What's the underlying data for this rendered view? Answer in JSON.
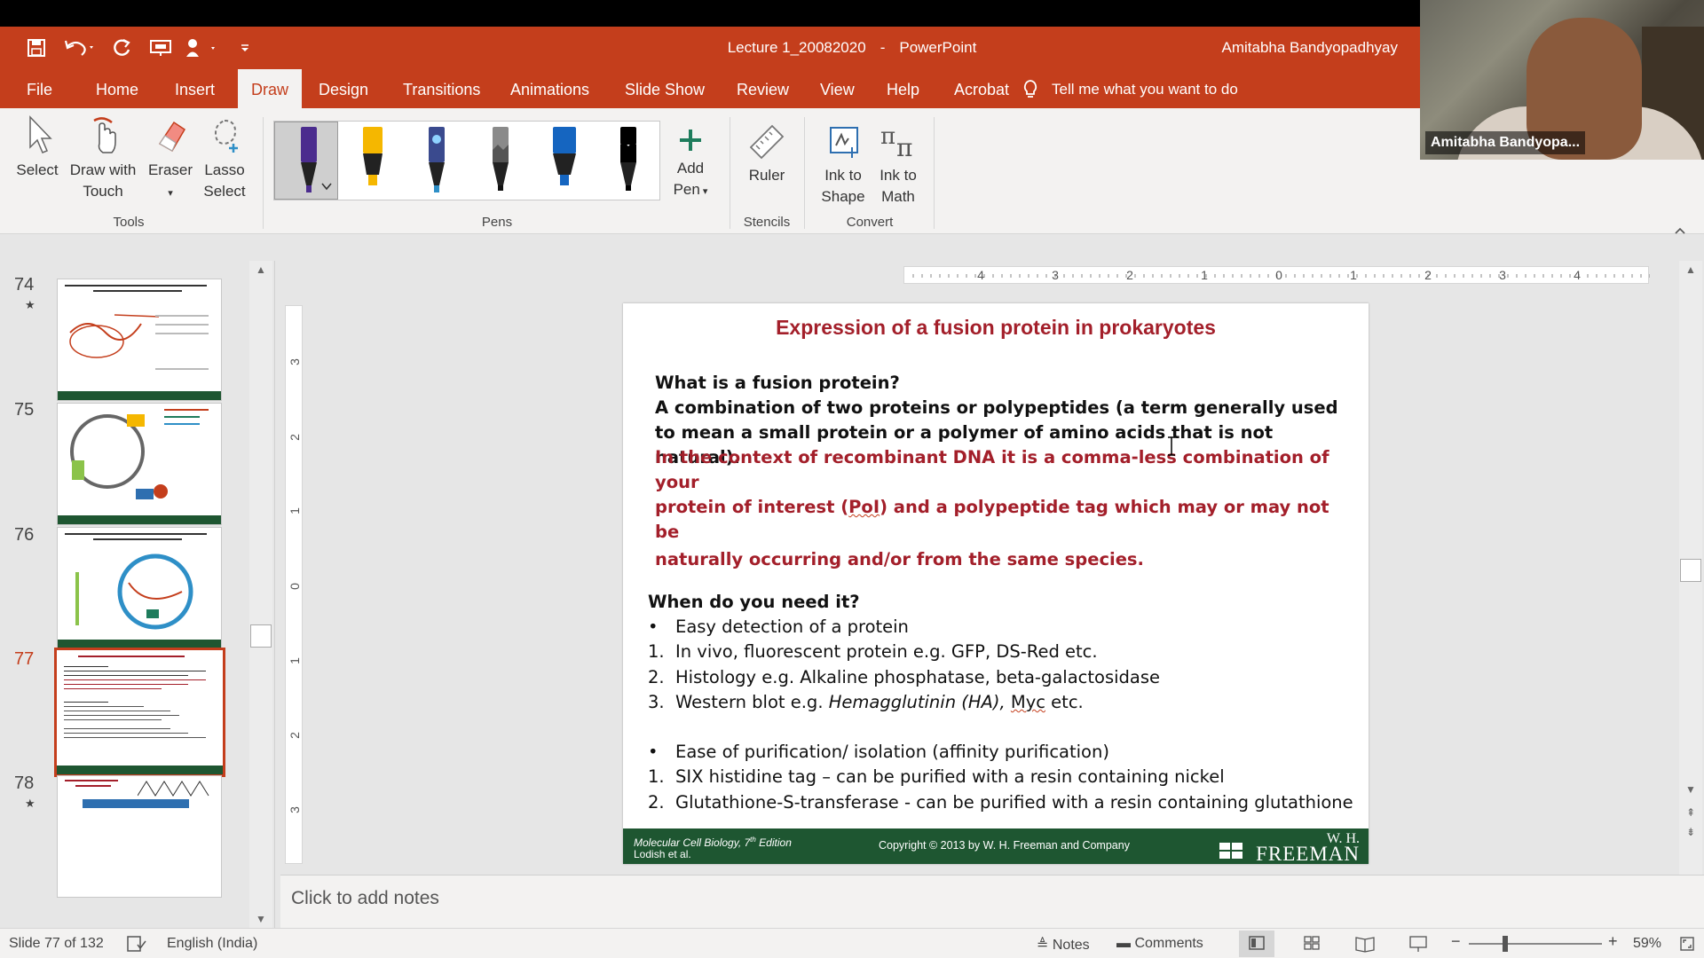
{
  "window": {
    "doc_name": "Lecture 1_20082020",
    "separator": "-",
    "app_name": "PowerPoint",
    "user": "Amitabha Bandyopadhyay"
  },
  "ribbon_tabs": [
    "File",
    "Home",
    "Insert",
    "Draw",
    "Design",
    "Transitions",
    "Animations",
    "Slide Show",
    "Review",
    "View",
    "Help",
    "Acrobat"
  ],
  "active_tab": "Draw",
  "tell_me": "Tell me what you want to do",
  "ribbon": {
    "tools": {
      "select": "Select",
      "draw_touch_1": "Draw with",
      "draw_touch_2": "Touch",
      "eraser": "Eraser",
      "lasso_1": "Lasso",
      "lasso_2": "Select",
      "label": "Tools"
    },
    "pens_label": "Pens",
    "pen_colors": [
      "#4b2c8e",
      "#f5b700",
      "#2e8fc7",
      "#8a8a8a",
      "#1565c0",
      "#000000"
    ],
    "add_pen_1": "Add",
    "add_pen_2": "Pen",
    "ruler": "Ruler",
    "stencils_label": "Stencils",
    "ink_shape_1": "Ink to",
    "ink_shape_2": "Shape",
    "ink_math_1": "Ink to",
    "ink_math_2": "Math",
    "convert_label": "Convert"
  },
  "webcam": {
    "name": "Amitabha Bandyopa..."
  },
  "thumbnails": [
    {
      "num": "74",
      "star": "★"
    },
    {
      "num": "75",
      "star": ""
    },
    {
      "num": "76",
      "star": ""
    },
    {
      "num": "77",
      "star": ""
    },
    {
      "num": "78",
      "star": "★"
    }
  ],
  "ruler": {
    "h_numbers": [
      "4",
      "3",
      "2",
      "1",
      "0",
      "1",
      "2",
      "3",
      "4"
    ],
    "v_numbers": [
      "3",
      "2",
      "1",
      "0",
      "1",
      "2",
      "3"
    ]
  },
  "slide": {
    "title": "Expression of a fusion protein in prokaryotes",
    "question": "What is a fusion protein?",
    "definition": "A combination of two proteins or polypeptides (a term generally used to mean a small protein or a polymer of amino acids that is not natural).",
    "context_1": "In the context of recombinant DNA it is a comma-less combination of your",
    "context_2a": "protein of interest (",
    "context_2b": "PoI",
    "context_2c": ") and a polypeptide tag which may or may not be",
    "context_3": "naturally occurring and/or from the same species.",
    "need_heading": "When do you need it?",
    "list1": [
      {
        "marker": "•",
        "text": "Easy detection of a protein"
      },
      {
        "marker": "1.",
        "text": "In vivo, fluorescent protein e.g. GFP, DS-Red etc."
      },
      {
        "marker": "2.",
        "text": "Histology e.g. Alkaline phosphatase, beta-galactosidase"
      }
    ],
    "western_marker": "3.",
    "western_a": "Western blot e.g. ",
    "western_b": "Hemagglutinin (HA)",
    "western_c": ", ",
    "western_d": "Myc",
    "western_e": " etc.",
    "list2": [
      {
        "marker": "•",
        "text": "Ease of purification/ isolation (affinity purification)"
      },
      {
        "marker": "1.",
        "text": "SIX histidine tag – can be purified with a resin containing nickel"
      },
      {
        "marker": "2.",
        "text": "Glutathione-S-transferase - can be purified with a resin containing glutathione"
      }
    ],
    "footer": {
      "book_a": "Molecular Cell Biology, 7",
      "book_sup": "th",
      "book_b": " Edition",
      "authors": "Lodish et al.",
      "copyright": "Copyright © 2013 by W. H. Freeman and Company",
      "logo_top": "W. H.",
      "logo_bottom": "FREEMAN"
    }
  },
  "notes_placeholder": "Click to add notes",
  "status": {
    "slide_info": "Slide 77 of 132",
    "language": "English (India)",
    "notes": "Notes",
    "comments": "Comments",
    "zoom": "59%"
  },
  "colors": {
    "accent": "#c43e1c",
    "slide_red": "#a31f2a",
    "footer_green": "#1e5631"
  }
}
